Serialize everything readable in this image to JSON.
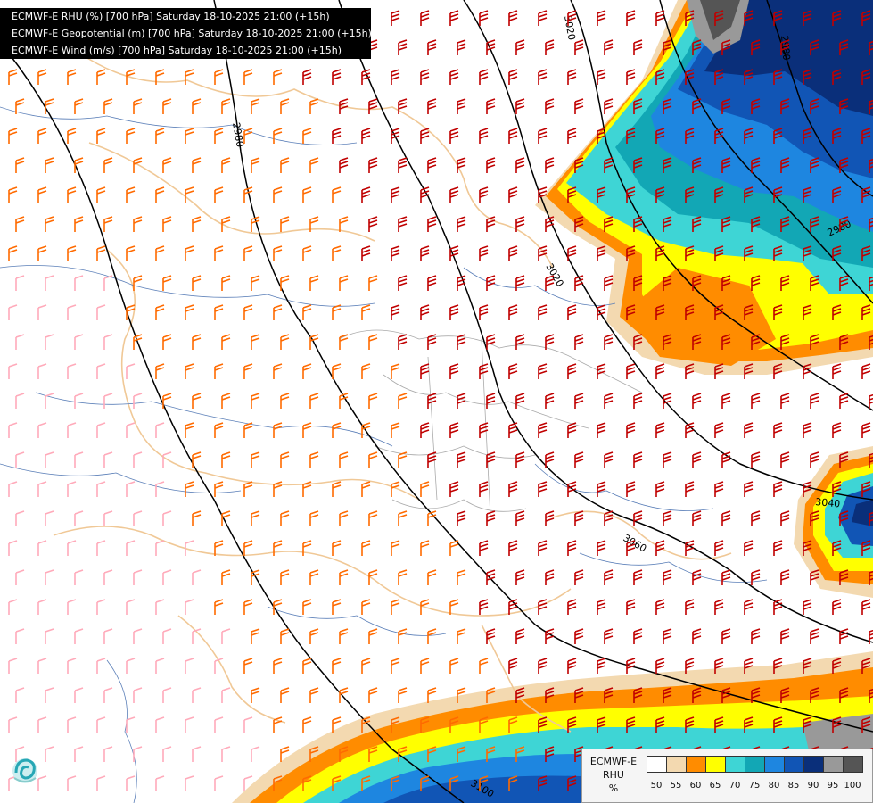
{
  "header": {
    "line1": "ECMWF-E RHU (%) [700 hPa] Saturday 18-10-2025 21:00 (+15h)",
    "line2": "ECMWF-E Geopotential (m) [700 hPa] Saturday 18-10-2025 21:00 (+15h)",
    "line3": "ECMWF-E Wind (m/s) [700 hPa] Saturday 18-10-2025 21:00 (+15h)"
  },
  "contours": {
    "labels": [
      "3020",
      "2980",
      "2980",
      "2980",
      "3020",
      "3040",
      "3060",
      "3100"
    ]
  },
  "legend": {
    "title": "ECMWF-E\nRHU\n%",
    "ticks": [
      "50",
      "55",
      "60",
      "65",
      "70",
      "75",
      "80",
      "85",
      "90",
      "95",
      "100"
    ],
    "colors": [
      "#ffffff",
      "#f3d9b0",
      "#ff8c00",
      "#ffff00",
      "#3ed5d5",
      "#12a7b5",
      "#1e86e0",
      "#1155b5",
      "#0a2f7a",
      "#999999",
      "#555555"
    ]
  },
  "colors": {
    "border": "#f0c896",
    "river": "#5b7fb8",
    "contour": "#000000",
    "barb_dark": "#c00000",
    "barb_mid": "#ff6a00",
    "barb_light": "#ffaaba"
  },
  "icons": {
    "logo": "ecmwf-swirl-logo"
  }
}
